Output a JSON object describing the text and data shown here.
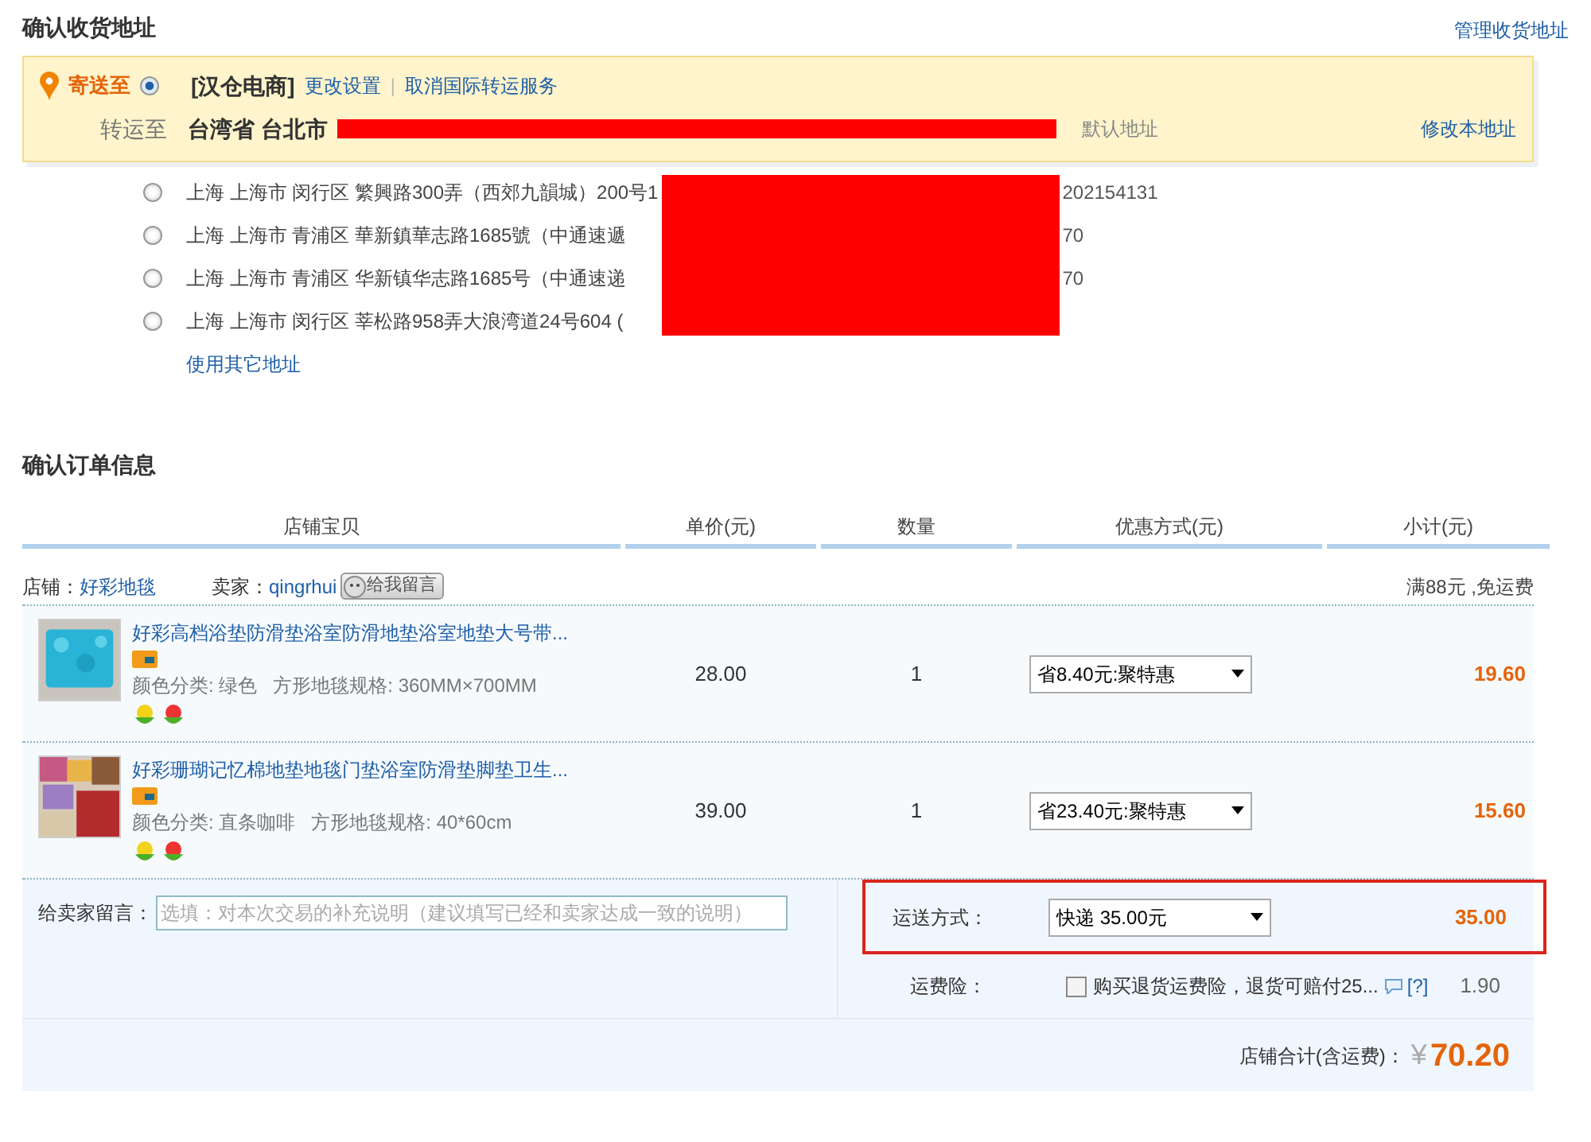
{
  "address_section": {
    "title": "确认收货地址",
    "manage_link": "管理收货地址",
    "current": {
      "label": "寄送至",
      "selected": true,
      "agent": "[汉仓电商]",
      "links": [
        "更改设置",
        "取消国际转运服务"
      ],
      "link_separator": "|",
      "forward_label": "转运至",
      "forward_address": "台湾省 台北市",
      "default_tag": "默认地址",
      "edit_link": "修改本地址"
    },
    "addresses": [
      {
        "text": "上海 上海市 闵行区 繁興路300弄（西郊九韻城）200号1",
        "tail": "202154131",
        "selected": false
      },
      {
        "text": "上海 上海市 青浦区 華新鎮華志路1685號（中通速遞",
        "tail": "70",
        "selected": false
      },
      {
        "text": "上海 上海市 青浦区 华新镇华志路1685号（中通速递",
        "tail": "70",
        "selected": false
      },
      {
        "text": "上海 上海市 闵行区 莘松路958弄大浪湾道24号604 (",
        "selected": false
      }
    ],
    "other_link": "使用其它地址"
  },
  "order_section": {
    "title": "确认订单信息",
    "columns": [
      "店铺宝贝",
      "单价(元)",
      "数量",
      "优惠方式(元)",
      "小计(元)"
    ],
    "shop": {
      "shop_label": "店铺：",
      "shop_name": "好彩地毯",
      "seller_label": "卖家：",
      "seller_name": "qingrhui",
      "message_button": "给我留言",
      "shipping_note": "满88元 ,免运费"
    },
    "items": [
      {
        "title": "好彩高档浴垫防滑垫浴室防滑地垫浴室地垫大号带...",
        "specs": "颜色分类: 绿色   方形地毯规格: 360MM×700MM",
        "price": "28.00",
        "quantity": "1",
        "discount": "省8.40元:聚特惠",
        "subtotal": "19.60"
      },
      {
        "title": "好彩珊瑚记忆棉地垫地毯门垫浴室防滑垫脚垫卫生...",
        "specs": "颜色分类: 直条咖啡   方形地毯规格: 40*60cm",
        "price": "39.00",
        "quantity": "1",
        "discount": "省23.40元:聚特惠",
        "subtotal": "15.60"
      }
    ],
    "message": {
      "label": "给卖家留言：",
      "placeholder": "选填：对本次交易的补充说明（建议填写已经和卖家达成一致的说明）"
    },
    "shipping": {
      "label": "运送方式：",
      "option": "快递 35.00元",
      "amount": "35.00",
      "highlighted": true
    },
    "insurance": {
      "label": "运费险：",
      "checked": false,
      "text": "购买退货运费险，退货可赔付25...",
      "help": "[?]",
      "amount": "1.90"
    },
    "total": {
      "label": "店铺合计(含运费)：",
      "currency": "¥",
      "amount": "70.20"
    }
  }
}
